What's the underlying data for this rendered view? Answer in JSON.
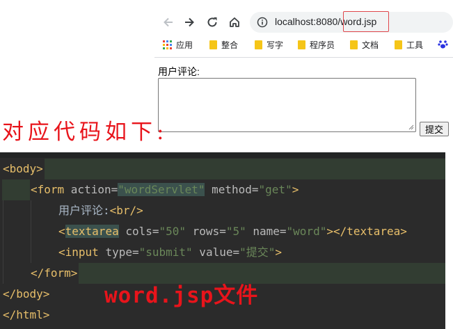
{
  "browser": {
    "back_icon": "arrow-left-icon",
    "forward_icon": "arrow-right-icon",
    "reload_icon": "reload-icon",
    "home_icon": "home-icon",
    "info_icon": "info-icon",
    "url_host": "localhost:8080",
    "url_slash": "/",
    "url_path": "word.jsp",
    "bookmarks": [
      {
        "label": "应用",
        "icon": "apps-grid-icon"
      },
      {
        "label": "整合",
        "icon": "folder-icon"
      },
      {
        "label": "写字",
        "icon": "folder-icon"
      },
      {
        "label": "程序员",
        "icon": "folder-icon"
      },
      {
        "label": "文档",
        "icon": "folder-icon"
      },
      {
        "label": "工具",
        "icon": "folder-icon"
      }
    ],
    "extra_icon": "baidu-paw-icon"
  },
  "page": {
    "comment_label": "用户评论:",
    "textarea_value": "",
    "submit_label": "提交"
  },
  "caption": "对应代码如下:",
  "annotation": "word.jsp文件",
  "code": {
    "body_open": "<body>",
    "form_open_a": "<form ",
    "form_attr_action": "action=",
    "form_val_action": "\"wordServlet\"",
    "form_attr_method": " method=",
    "form_val_method": "\"get\"",
    "form_close_bracket": ">",
    "label_text": "用户评论:",
    "br_tag": "<br/>",
    "ta_lt": "<",
    "ta_name": "textarea",
    "ta_attr_cols": " cols=",
    "ta_val_cols": "\"50\"",
    "ta_attr_rows": " rows=",
    "ta_val_rows": "\"5\"",
    "ta_attr_name": " name=",
    "ta_val_name": "\"word\"",
    "ta_end": "></textarea>",
    "input_open": "<input ",
    "input_attr_type": "type=",
    "input_val_type": "\"submit\"",
    "input_attr_value": " value=",
    "input_val_value": "\"提交\"",
    "input_end": ">",
    "form_close": "</form>",
    "body_close": "</body>",
    "html_close": "</html>"
  },
  "colors": {
    "accent_red": "#e8141b",
    "editor_bg": "#2b2b2b",
    "tag": "#e8bf6a",
    "string": "#6a8759"
  }
}
